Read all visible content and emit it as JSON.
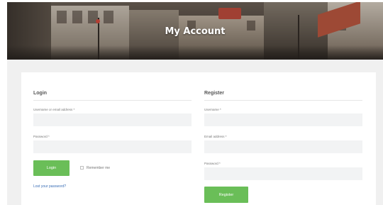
{
  "page": {
    "title": "My Account"
  },
  "login": {
    "heading": "Login",
    "username_label": "Username or email address *",
    "username_value": "",
    "password_label": "Password *",
    "password_value": "",
    "login_button": "Login",
    "remember_me_label": "Remember me",
    "lost_password_link": "Lost your password?"
  },
  "register": {
    "heading": "Register",
    "username_label": "Username *",
    "username_value": "",
    "email_label": "Email address *",
    "email_value": "",
    "password_label": "Password *",
    "password_value": "",
    "register_button": "Register"
  },
  "colors": {
    "button_green": "#6abe58",
    "link_blue": "#3b6fb6",
    "section_gray": "#f0f0f0",
    "input_gray": "#f2f3f4"
  }
}
